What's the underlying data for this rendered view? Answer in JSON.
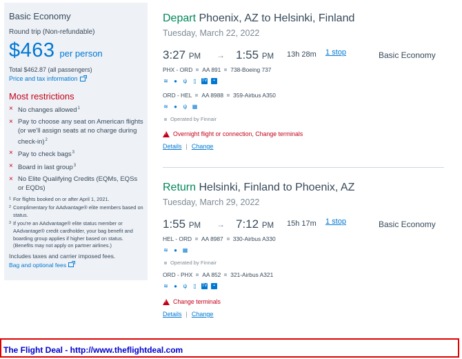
{
  "fare": {
    "name": "Basic Economy",
    "trip_type": "Round trip (Non-refundable)",
    "price": "$463",
    "per_person": "per person",
    "total": "Total $462.87 (all passengers)",
    "price_tax_link": "Price and tax information",
    "restrictions_title": "Most restrictions",
    "restrictions": [
      {
        "text": "No changes allowed",
        "sup": "1"
      },
      {
        "text": "Pay to choose any seat on American flights (or we'll assign seats at no charge during check-in)",
        "sup": "2"
      },
      {
        "text": "Pay to check bags",
        "sup": "3"
      },
      {
        "text": "Board in last group",
        "sup": "3"
      },
      {
        "text": "No Elite Qualifying Credits (EQMs, EQSs or EQDs)",
        "sup": ""
      }
    ],
    "notes": [
      {
        "n": "1",
        "text": "For flights booked on or after April 1, 2021."
      },
      {
        "n": "2",
        "text": "Complimentary for AAdvantage® elite members based on status."
      },
      {
        "n": "3",
        "text": "If you're an AAdvantage® elite status member or AAdvantage® credit cardholder, your bag benefit and boarding group applies if higher based on status. (Benefits may not apply on partner airlines.)"
      }
    ],
    "taxes_note": "Includes taxes and carrier imposed fees.",
    "bag_link": "Bag and optional fees"
  },
  "depart": {
    "keyword": "Depart",
    "route": "Phoenix, AZ to Helsinki, Finland",
    "date": "Tuesday, March 22, 2022",
    "dep_time": "3:27",
    "dep_ampm": "PM",
    "arrow": "→",
    "arr_time": "1:55",
    "arr_ampm": "PM",
    "duration": "13h  28m",
    "stops": "1 stop",
    "cabin": "Basic Economy",
    "seg1": {
      "route": "PHX - ORD",
      "flight": "AA 891",
      "aircraft": "738-Boeing 737"
    },
    "seg2": {
      "route": "ORD - HEL",
      "flight": "AA 8988",
      "aircraft": "359-Airbus A350"
    },
    "operated_by": "Operated by Finnair",
    "warning": "Overnight flight or connection, Change terminals",
    "details_link": "Details",
    "change_link": "Change",
    "separator": "|"
  },
  "return": {
    "keyword": "Return",
    "route": "Helsinki, Finland to Phoenix, AZ",
    "date": "Tuesday, March 29, 2022",
    "dep_time": "1:55",
    "dep_ampm": "PM",
    "arrow": "→",
    "arr_time": "7:12",
    "arr_ampm": "PM",
    "duration": "15h  17m",
    "stops": "1 stop",
    "cabin": "Basic Economy",
    "seg1": {
      "route": "HEL - ORD",
      "flight": "AA 8987",
      "aircraft": "330-Airbus A330"
    },
    "seg2": {
      "route": "ORD - PHX",
      "flight": "AA 852",
      "aircraft": "321-Airbus A321"
    },
    "operated_by": "Operated by Finnair",
    "warning": "Change terminals",
    "details_link": "Details",
    "change_link": "Change",
    "separator": "|"
  },
  "footer": {
    "text": "The Flight Deal - http://www.theflightdeal.com"
  },
  "colors": {
    "accent_blue": "#0078d2",
    "green": "#00875a",
    "red": "#c30019",
    "panel_bg": "#eef1f6",
    "footer_border": "#e00000",
    "footer_text": "#0000cc"
  }
}
